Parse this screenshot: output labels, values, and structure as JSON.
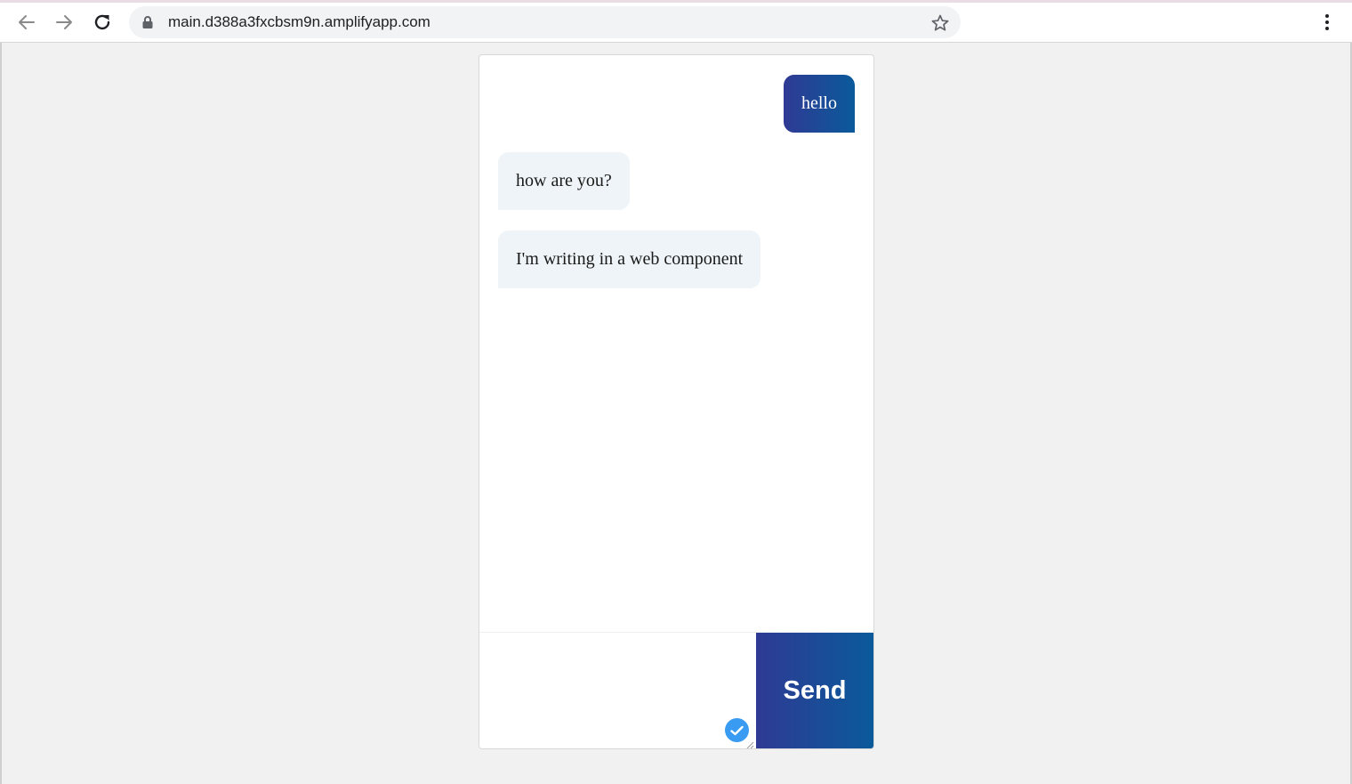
{
  "browser": {
    "url": "main.d388a3fxcbsm9n.amplifyapp.com",
    "icons": {
      "back": "arrow-left-icon",
      "forward": "arrow-right-icon",
      "reload": "reload-icon",
      "lock": "lock-icon",
      "bookmark": "star-icon",
      "menu": "kebab-menu-icon"
    }
  },
  "chat": {
    "messages": [
      {
        "from": "user",
        "text": "hello"
      },
      {
        "from": "other",
        "text": "how are you?"
      },
      {
        "from": "other",
        "text": "I'm writing in a web component"
      }
    ],
    "composer": {
      "input_value": "",
      "send_label": "Send",
      "status_icon": "check-circle-icon"
    },
    "colors": {
      "accent_start": "#2f3a94",
      "accent_end": "#0a5a9a",
      "incoming_bubble": "#eef4f7",
      "status_badge": "#3a9bf2"
    }
  }
}
